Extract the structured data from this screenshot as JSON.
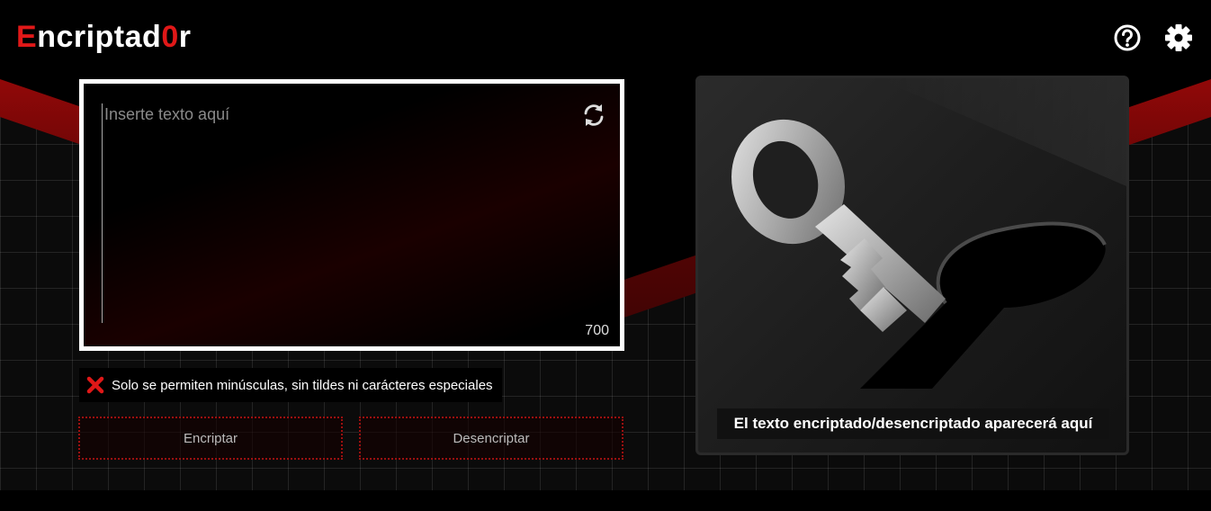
{
  "header": {
    "logo_first": "E",
    "logo_mid": "ncriptad",
    "logo_accent": "0",
    "logo_last": "r",
    "help_icon": "help-circle-icon",
    "settings_icon": "gear-icon"
  },
  "input": {
    "placeholder": "Inserte texto aquí",
    "char_count": "700",
    "reset_icon": "refresh-icon"
  },
  "warning": {
    "icon": "x-icon",
    "text": "Solo se permiten minúsculas, sin tildes ni carácteres especiales"
  },
  "buttons": {
    "encrypt": "Encriptar",
    "decrypt": "Desencriptar"
  },
  "output": {
    "illustration": "key-keyhole-icon",
    "message": "El texto encriptado/desencriptado aparecerá aquí"
  },
  "colors": {
    "accent": "#e01818",
    "background": "#000000",
    "button_border": "#9a1010"
  }
}
